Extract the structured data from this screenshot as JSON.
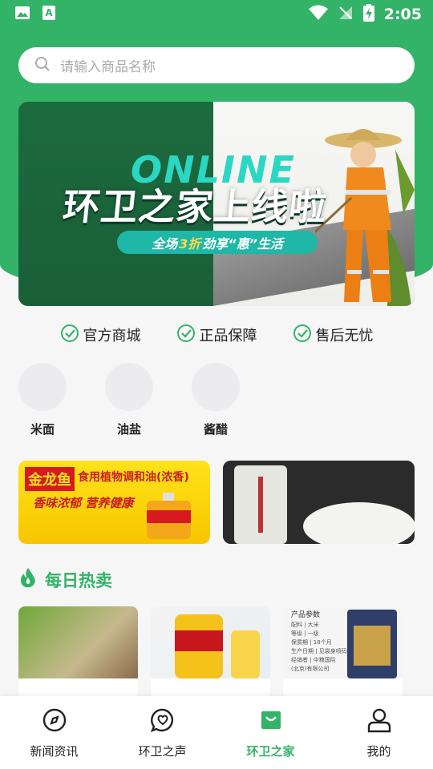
{
  "status_bar": {
    "time": "2:05"
  },
  "search": {
    "placeholder": "请输入商品名称"
  },
  "banner": {
    "online_text": "ONLINE",
    "headline": "环卫之家上线啦",
    "pill_prefix": "全场",
    "pill_highlight": "3折",
    "pill_suffix": "劲享“惠”生活"
  },
  "guarantees": [
    "官方商城",
    "正品保障",
    "售后无忧"
  ],
  "categories": [
    "米面",
    "油盐",
    "酱醋"
  ],
  "promos": {
    "left_brand": "金龙鱼",
    "left_slogan_1": "食用植物调和油(浓香)",
    "left_slogan_2": "香味浓郁 营养健康"
  },
  "hot_section": {
    "title": "每日热卖"
  },
  "products": {
    "p3_heading": "产品参数",
    "p3_spec": [
      "配料 | 大米",
      "等级 | 一级",
      "保质期 | 18个月",
      "生产日期 | 见袋身喷码",
      "经销者 | 中粮国际",
      "(北京)有限公司"
    ]
  },
  "tabbar": {
    "items": [
      "新闻资讯",
      "环卫之声",
      "环卫之家",
      "我的"
    ],
    "active_index": 2
  },
  "colors": {
    "accent": "#33b368"
  }
}
